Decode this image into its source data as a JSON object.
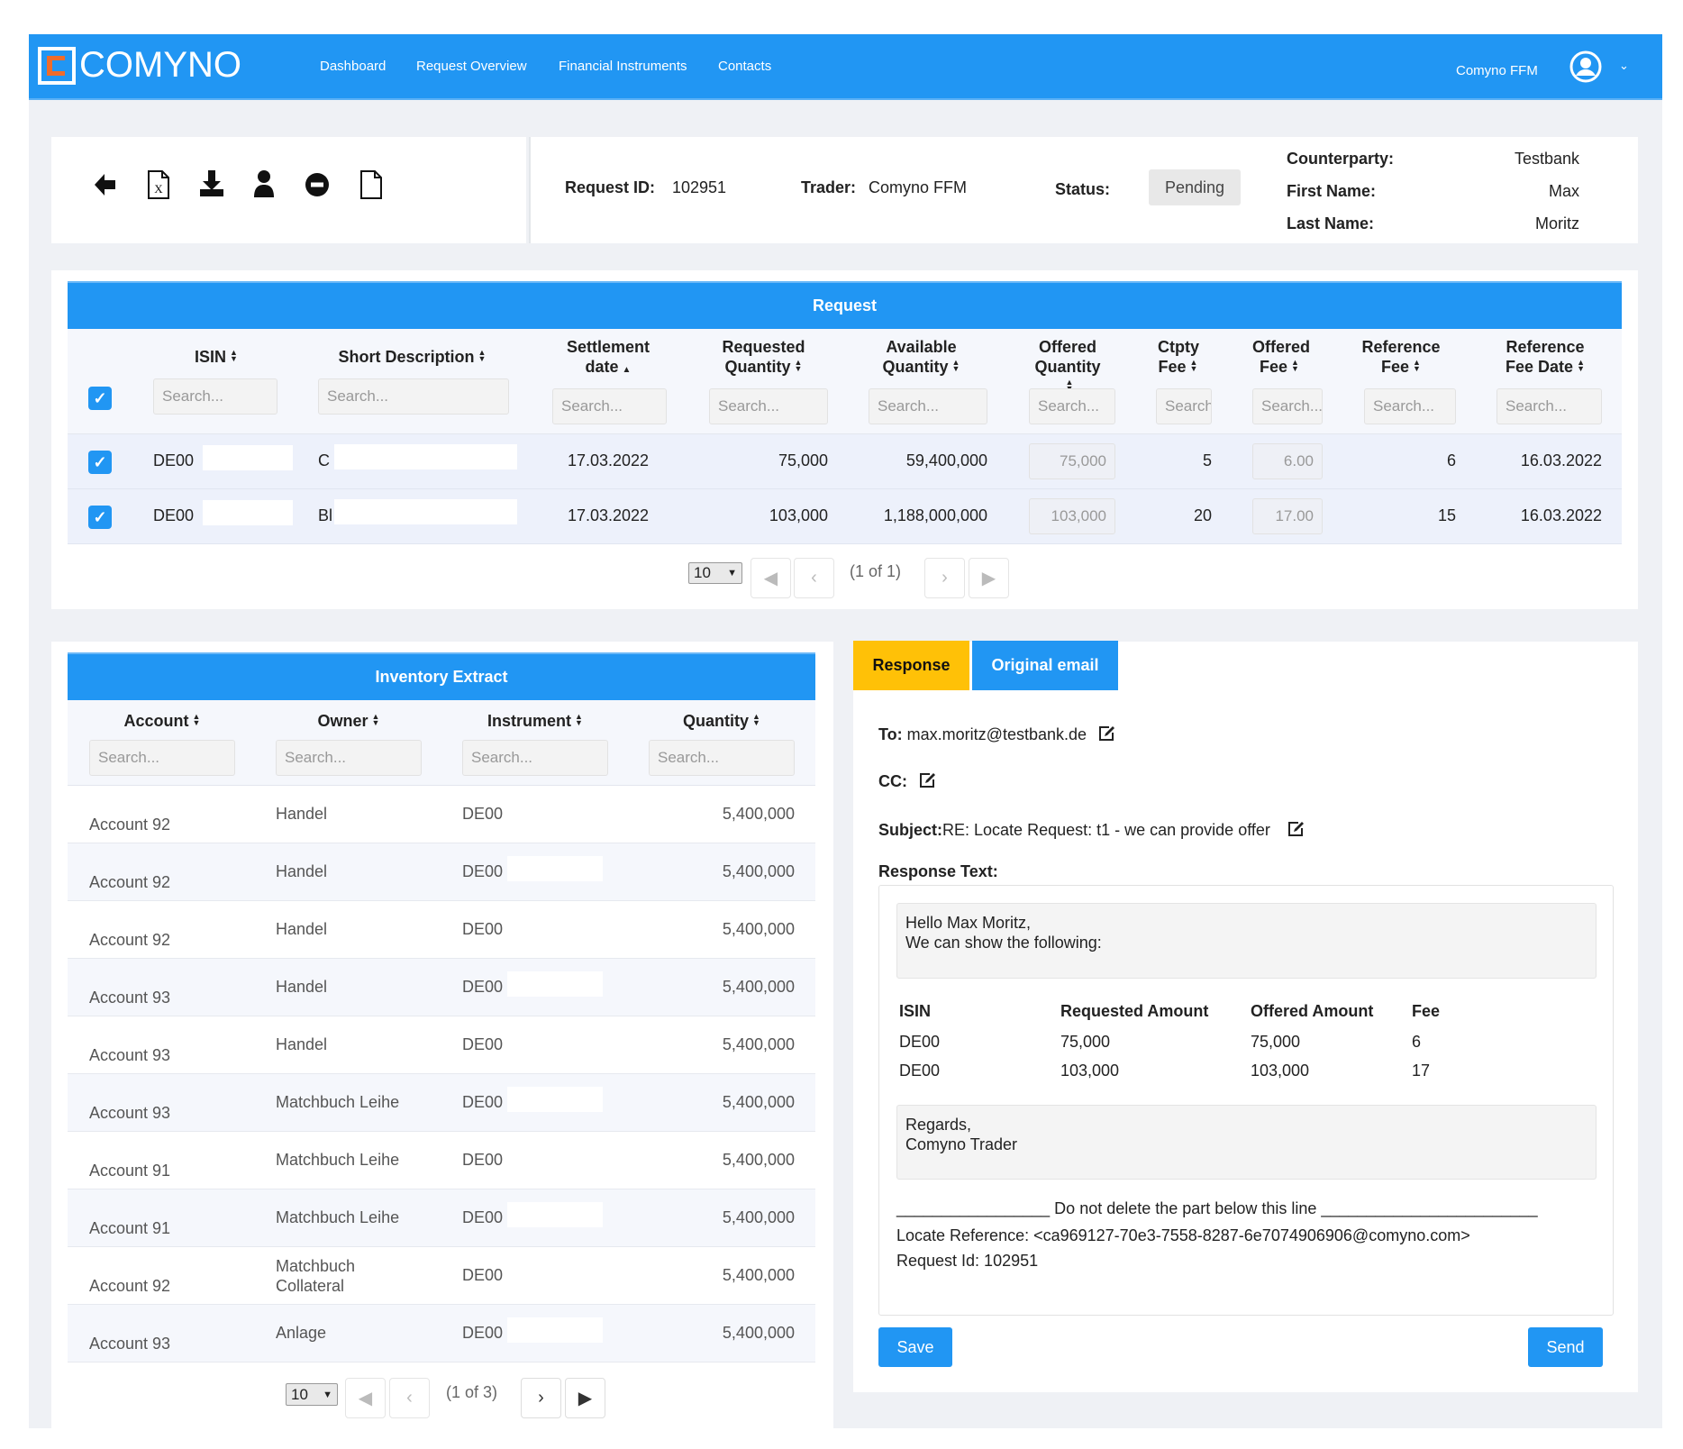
{
  "colors": {
    "primary": "#2196f3",
    "accent": "#ffc107",
    "background": "#eff1f5"
  },
  "header": {
    "logo": "COMYNO",
    "nav": [
      "Dashboard",
      "Request Overview",
      "Financial Instruments",
      "Contacts"
    ],
    "user": "Comyno FFM",
    "icons": [
      "user-circle-icon",
      "chevron-down-icon"
    ]
  },
  "toolbar": {
    "icons": [
      "arrow-left-icon",
      "excel-file-icon",
      "download-icon",
      "user-icon",
      "minus-circle-icon",
      "file-icon"
    ]
  },
  "info": {
    "request_id_label": "Request ID:",
    "request_id": "102951",
    "trader_label": "Trader:",
    "trader": "Comyno FFM",
    "status_label": "Status:",
    "status": "Pending",
    "counterparty_label": "Counterparty:",
    "counterparty": "Testbank",
    "first_name_label": "First Name:",
    "first_name": "Max",
    "last_name_label": "Last Name:",
    "last_name": "Moritz"
  },
  "request": {
    "title": "Request",
    "columns": [
      "ISIN",
      "Short Description",
      "Settlement date",
      "Requested Quantity",
      "Available Quantity",
      "Offered Quantity",
      "Ctpty Fee",
      "Offered Fee",
      "Reference Fee",
      "Reference Fee Date"
    ],
    "search_placeholder": "Search...",
    "rows": [
      {
        "isin": "DE00",
        "desc": "C",
        "settlement": "17.03.2022",
        "requested": "75,000",
        "available": "59,400,000",
        "offered_qty": "75,000",
        "ctpty_fee": "5",
        "offered_fee": "6.00",
        "ref_fee": "6",
        "ref_date": "16.03.2022",
        "checked": true
      },
      {
        "isin": "DE00",
        "desc": "Bl",
        "settlement": "17.03.2022",
        "requested": "103,000",
        "available": "1,188,000,000",
        "offered_qty": "103,000",
        "ctpty_fee": "20",
        "offered_fee": "17.00",
        "ref_fee": "15",
        "ref_date": "16.03.2022",
        "checked": true
      }
    ],
    "page_size": "10",
    "page_info": "(1 of 1)"
  },
  "inventory": {
    "title": "Inventory Extract",
    "columns": [
      "Account",
      "Owner",
      "Instrument",
      "Quantity"
    ],
    "search_placeholder": "Search...",
    "rows": [
      {
        "account": "Account 92",
        "owner": "Handel",
        "instrument": "DE00",
        "quantity": "5,400,000"
      },
      {
        "account": "Account 92",
        "owner": "Handel",
        "instrument": "DE00",
        "quantity": "5,400,000"
      },
      {
        "account": "Account 92",
        "owner": "Handel",
        "instrument": "DE00",
        "quantity": "5,400,000"
      },
      {
        "account": "Account 93",
        "owner": "Handel",
        "instrument": "DE00",
        "quantity": "5,400,000"
      },
      {
        "account": "Account 93",
        "owner": "Handel",
        "instrument": "DE00",
        "quantity": "5,400,000"
      },
      {
        "account": "Account 93",
        "owner": "Matchbuch Leihe",
        "instrument": "DE00",
        "quantity": "5,400,000"
      },
      {
        "account": "Account 91",
        "owner": "Matchbuch Leihe",
        "instrument": "DE00",
        "quantity": "5,400,000"
      },
      {
        "account": "Account 91",
        "owner": "Matchbuch Leihe",
        "instrument": "DE00",
        "quantity": "5,400,000"
      },
      {
        "account": "Account 92",
        "owner": "Matchbuch Collateral",
        "instrument": "DE00",
        "quantity": "5,400,000"
      },
      {
        "account": "Account 93",
        "owner": "Anlage",
        "instrument": "DE00",
        "quantity": "5,400,000"
      }
    ],
    "page_size": "10",
    "page_info": "(1 of 3)"
  },
  "response": {
    "tabs": [
      "Response",
      "Original email"
    ],
    "to_label": "To:",
    "to": "max.moritz@testbank.de",
    "cc_label": "CC:",
    "subject_label": "Subject:",
    "subject": "RE: Locate Request: t1 - we can provide offer",
    "text_label": "Response Text:",
    "greeting": [
      "Hello Max Moritz,",
      "We can show the following:"
    ],
    "table": {
      "columns": [
        "ISIN",
        "Requested Amount",
        "Offered Amount",
        "Fee"
      ],
      "rows": [
        [
          "DE00",
          "75,000",
          "75,000",
          "6"
        ],
        [
          "DE00",
          "103,000",
          "103,000",
          "17"
        ]
      ]
    },
    "closing": [
      "Regards,",
      "Comyno Trader"
    ],
    "separator": "_________________ Do not delete the part below this line ________________________",
    "locate_ref": "Locate Reference: <ca969127-70e3-7558-8287-6e7074906906@comyno.com>",
    "request_id_line": "Request Id: 102951",
    "save": "Save",
    "send": "Send"
  }
}
